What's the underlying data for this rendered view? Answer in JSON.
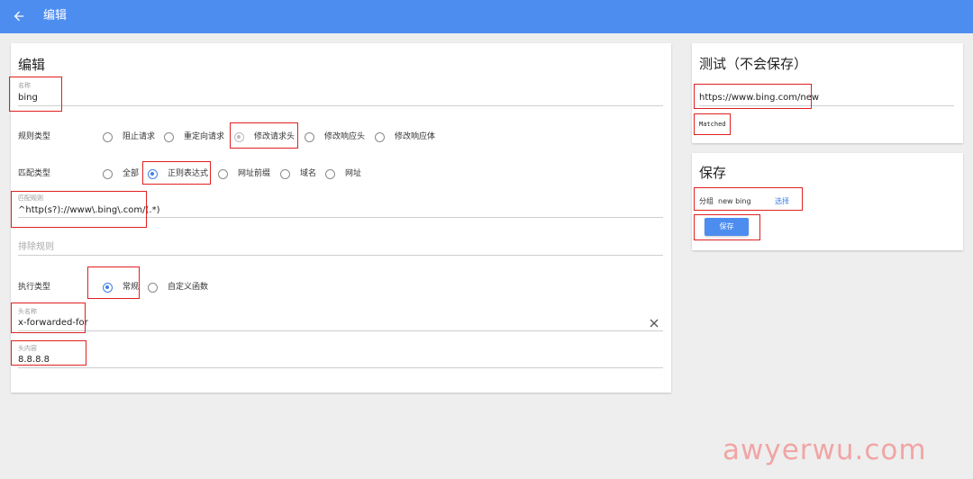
{
  "topbar": {
    "title": "编辑",
    "back_icon": "arrow-left-icon"
  },
  "edit_card": {
    "title": "编辑",
    "name": {
      "label": "名称",
      "value": "bing"
    },
    "rule_type": {
      "label": "规则类型",
      "options": [
        "阻止请求",
        "重定向请求",
        "修改请求头",
        "修改响应头",
        "修改响应体"
      ],
      "selected": "修改请求头"
    },
    "match_type": {
      "label": "匹配类型",
      "options": [
        "全部",
        "正则表达式",
        "网址前缀",
        "域名",
        "网址"
      ],
      "selected": "正则表达式"
    },
    "match_rule": {
      "label": "匹配规则",
      "value": "^http(s?)://www\\.bing\\.com/(.*)"
    },
    "exclude_rule": {
      "placeholder": "排除规则"
    },
    "exec_type": {
      "label": "执行类型",
      "options": [
        "常规",
        "自定义函数"
      ],
      "selected": "常规"
    },
    "header_name": {
      "label": "头名称",
      "value": "x-forwarded-for",
      "clear_icon": "close-icon"
    },
    "header_value": {
      "label": "头内容",
      "value": "8.8.8.8"
    }
  },
  "test_card": {
    "title": "测试（不会保存）",
    "url_value": "https://www.bing.com/new",
    "result": "Matched"
  },
  "save_card": {
    "title": "保存",
    "group_label": "分组",
    "group_value": "new bing",
    "select_link": "选择",
    "save_button": "保存"
  },
  "watermark": "awyerwu.com",
  "colors": {
    "topbar": "#4d8df0",
    "accent": "#3f7ee8",
    "highlight_box": "#e02020",
    "background": "#eeeeee"
  }
}
